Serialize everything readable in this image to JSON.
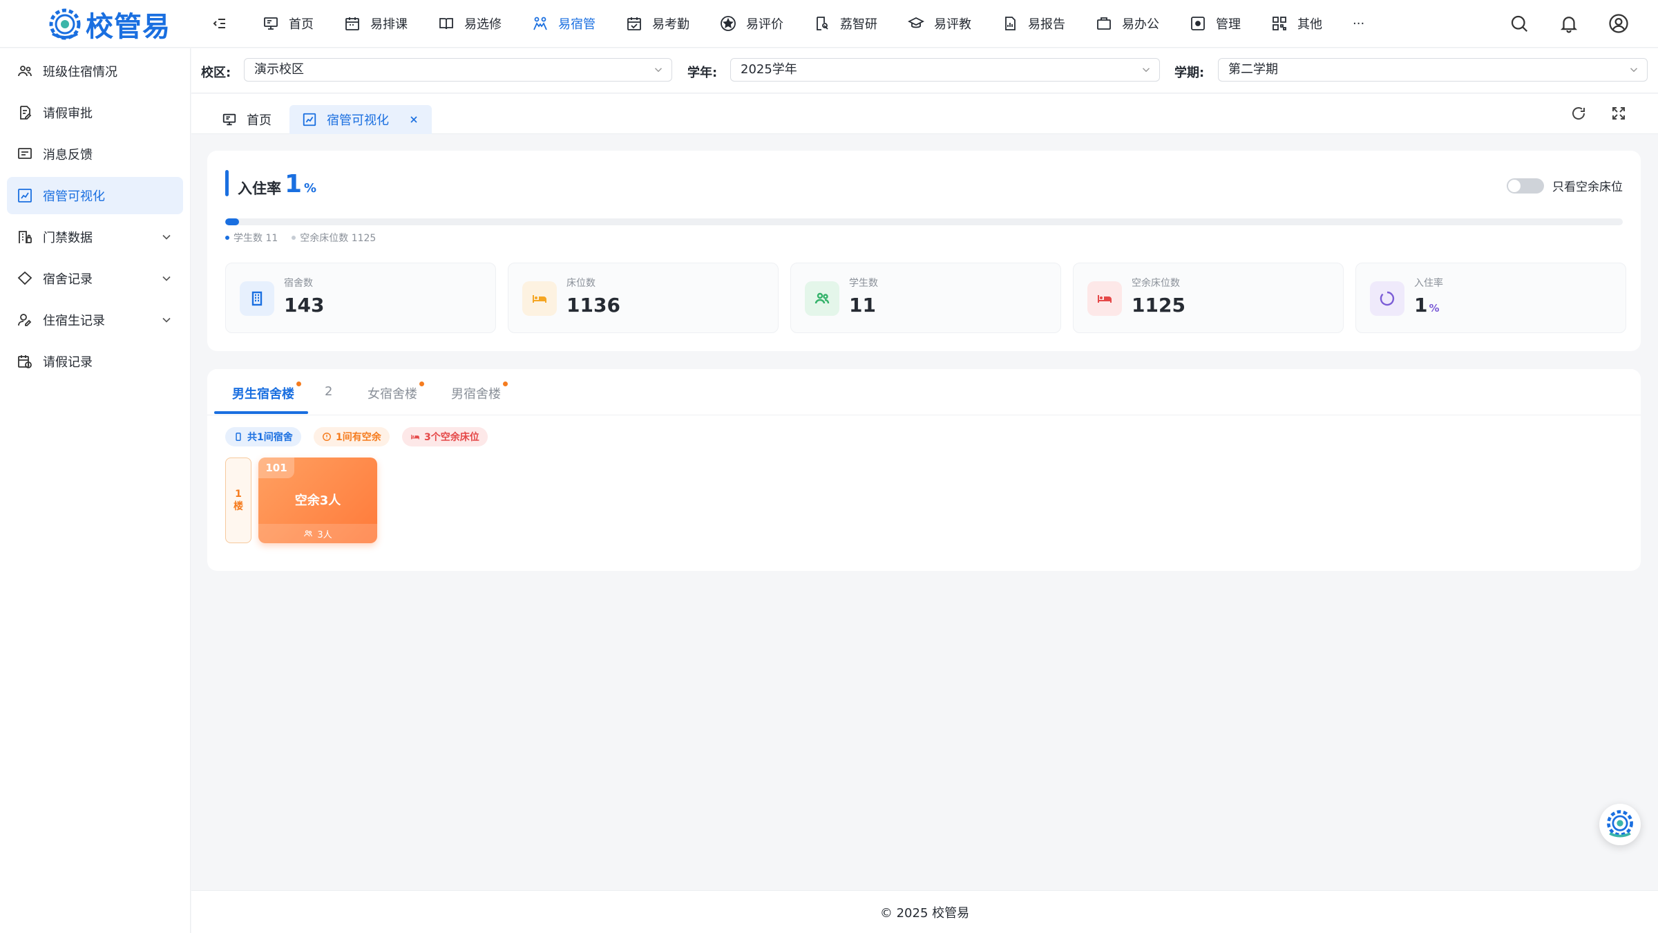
{
  "app": {
    "name": "校管易",
    "brand_color": "#1a6fe0"
  },
  "topnav": [
    {
      "label": "首页",
      "icon": "monitor-icon"
    },
    {
      "label": "易排课",
      "icon": "calendar-icon"
    },
    {
      "label": "易选修",
      "icon": "book-icon"
    },
    {
      "label": "易宿管",
      "icon": "dorm-icon",
      "active": true
    },
    {
      "label": "易考勤",
      "icon": "calendar-check-icon"
    },
    {
      "label": "易评价",
      "icon": "star-icon"
    },
    {
      "label": "荔智研",
      "icon": "research-icon"
    },
    {
      "label": "易评教",
      "icon": "graduation-cap-icon"
    },
    {
      "label": "易报告",
      "icon": "report-icon"
    },
    {
      "label": "易办公",
      "icon": "briefcase-icon"
    },
    {
      "label": "管理",
      "icon": "gear-icon"
    },
    {
      "label": "其他",
      "icon": "grid-icon"
    },
    {
      "label": "···",
      "icon": "more-icon"
    }
  ],
  "sidebar": [
    {
      "label": "班级住宿情况",
      "icon": "users-icon"
    },
    {
      "label": "请假审批",
      "icon": "doc-edit-icon"
    },
    {
      "label": "消息反馈",
      "icon": "message-icon"
    },
    {
      "label": "宿管可视化",
      "icon": "chart-icon",
      "active": true
    },
    {
      "label": "门禁数据",
      "icon": "building-lock-icon",
      "expandable": true
    },
    {
      "label": "宿舍记录",
      "icon": "house-icon",
      "expandable": true
    },
    {
      "label": "住宿生记录",
      "icon": "user-edit-icon",
      "expandable": true
    },
    {
      "label": "请假记录",
      "icon": "calendar-clock-icon"
    }
  ],
  "filters": {
    "campus": {
      "label": "校区:",
      "value": "演示校区"
    },
    "year": {
      "label": "学年:",
      "value": "2025学年"
    },
    "term": {
      "label": "学期:",
      "value": "第二学期"
    }
  },
  "page_tabs": [
    {
      "label": "首页",
      "icon": "monitor-icon"
    },
    {
      "label": "宿管可视化",
      "icon": "chart-icon",
      "active": true,
      "closable": true
    }
  ],
  "occupancy": {
    "label": "入住率",
    "value": "1",
    "unit": "%",
    "fill_fraction": 0.0097,
    "toggle_label": "只看空余床位",
    "legend": {
      "students": "学生数 11",
      "free_beds": "空余床位数 1125"
    }
  },
  "stats": [
    {
      "label": "宿舍数",
      "value": "143",
      "icon": "building-icon",
      "color": "#1a6fe0",
      "bg": "#e7f0fd"
    },
    {
      "label": "床位数",
      "value": "1136",
      "icon": "bed-icon",
      "color": "#f5a623",
      "bg": "#fdf2e1"
    },
    {
      "label": "学生数",
      "value": "11",
      "icon": "users-icon",
      "color": "#34b26a",
      "bg": "#e4f6ea"
    },
    {
      "label": "空余床位数",
      "value": "1125",
      "icon": "bed-icon",
      "color": "#e54848",
      "bg": "#fde8e8"
    },
    {
      "label": "入住率",
      "value": "1",
      "unit": "%",
      "icon": "ring-icon",
      "color": "#7b5cd6",
      "bg": "#efeafb"
    }
  ],
  "building_tabs": [
    {
      "label": "男生宿舍楼",
      "active": true,
      "dot": true
    },
    {
      "label": "2",
      "dot": false
    },
    {
      "label": "女宿舍楼",
      "dot": true
    },
    {
      "label": "男宿舍楼",
      "dot": true
    }
  ],
  "chips": [
    {
      "label": "共1间宿舍",
      "color": "#1a6fe0",
      "bg": "#e7f0fd"
    },
    {
      "label": "1间有空余",
      "color": "#f57c1f",
      "bg": "#fff1e6"
    },
    {
      "label": "3个空余床位",
      "color": "#e54848",
      "bg": "#fde8e8"
    }
  ],
  "floor": {
    "label": "1\n楼"
  },
  "room": {
    "number": "101",
    "status": "空余3人",
    "capacity": "3人"
  },
  "footer": "© 2025 校管易"
}
